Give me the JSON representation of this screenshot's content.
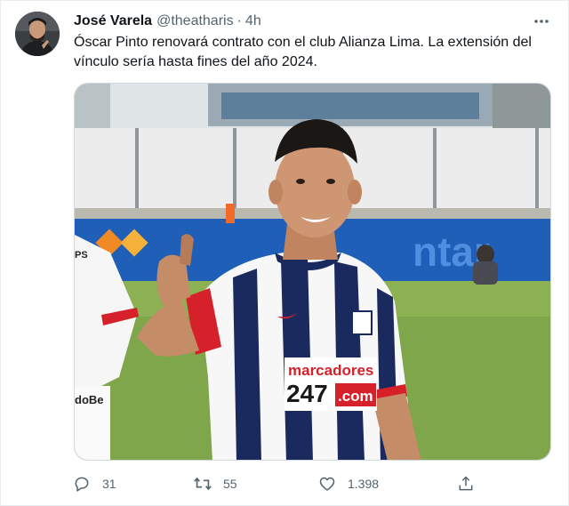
{
  "tweet": {
    "author_name": "José Varela",
    "handle": "@theatharis",
    "separator": "·",
    "time": "4h",
    "text": "Óscar Pinto renovará contrato con el club Alianza Lima. La extensión del vínculo sería hasta fines del año 2024.",
    "media": {
      "jersey_sponsor_top": "marcadores",
      "jersey_sponsor_num": "247",
      "jersey_sponsor_dotcom": ".com",
      "ad_board_text": "ntar",
      "sleeve_text": "doBe",
      "shorts_text": "PS"
    },
    "actions": {
      "replies": "31",
      "retweets": "55",
      "likes": "1.398"
    }
  },
  "colors": {
    "accent": "#1d9bf0",
    "secondary_text": "#536471",
    "primary_text": "#0f1419"
  }
}
